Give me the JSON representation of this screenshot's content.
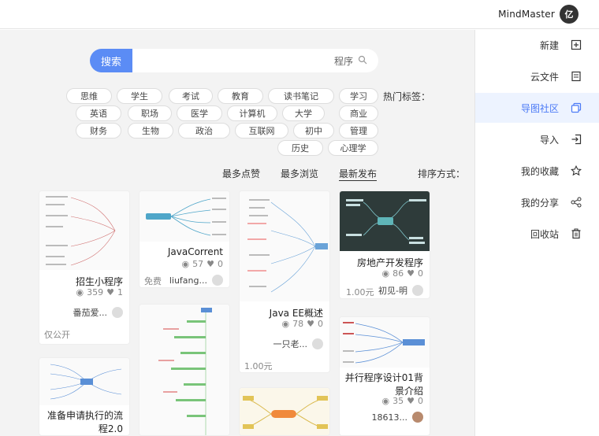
{
  "app": {
    "brand": "MindMaster",
    "logo_glyph": "亿"
  },
  "sidebar": {
    "items": [
      {
        "label": "新建",
        "icon": "new-file-icon"
      },
      {
        "label": "云文件",
        "icon": "cloud-file-icon"
      },
      {
        "label": "导图社区",
        "icon": "community-icon",
        "active": true
      },
      {
        "label": "导入",
        "icon": "import-icon"
      },
      {
        "label": "我的收藏",
        "icon": "star-icon"
      },
      {
        "label": "我的分享",
        "icon": "share-icon"
      },
      {
        "label": "回收站",
        "icon": "trash-icon"
      }
    ],
    "active_color": "#4a79f6"
  },
  "search": {
    "button": "搜索",
    "value": "程序"
  },
  "tags": {
    "label": "热门标签：",
    "items": [
      "学习",
      "读书笔记",
      "教育",
      "考试",
      "学生",
      "思维",
      "商业",
      "大学",
      "计算机",
      "医学",
      "职场",
      "英语",
      "管理",
      "初中",
      "互联网",
      "政治",
      "生物",
      "财务",
      "心理学",
      "历史"
    ]
  },
  "sort": {
    "label": "排序方式：",
    "options": [
      "最新发布",
      "最多浏览",
      "最多点赞"
    ]
  },
  "cards": [
    {
      "title": "房地产开发程序",
      "views": "86",
      "likes": "0",
      "author": "初见-明",
      "price": "1.00元"
    },
    {
      "title": "Java EE概述",
      "views": "78",
      "likes": "0",
      "author": "一只老...",
      "price": "1.00元"
    },
    {
      "title": "JavaCorrent",
      "views": "57",
      "likes": "0",
      "author": "liufang...",
      "price": "免费"
    },
    {
      "title": "招生小程序",
      "views": "359",
      "likes": "1",
      "author": "番茄爱...",
      "price": "仅公开"
    },
    {
      "title": "并行程序设计01背景介绍",
      "views": "35",
      "likes": "0",
      "author": "18613...",
      "price": ""
    },
    {
      "title": "准备申请执行的流程2.0",
      "views": "",
      "likes": "",
      "author": "",
      "price": ""
    }
  ]
}
